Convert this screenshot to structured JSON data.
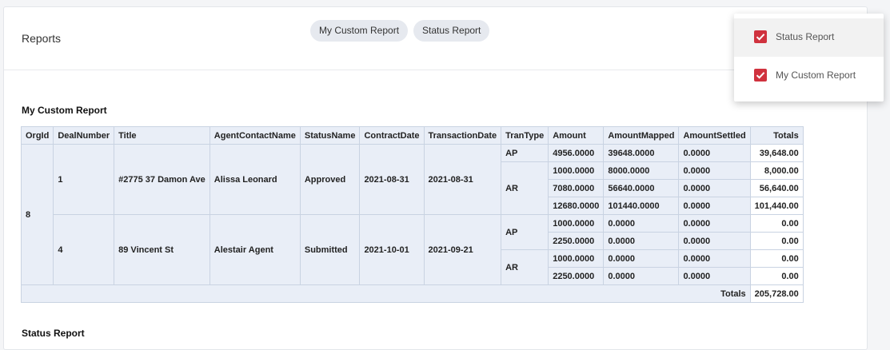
{
  "header": {
    "title": "Reports",
    "chips": [
      "My Custom Report",
      "Status Report"
    ]
  },
  "dropdown": {
    "items": [
      {
        "label": "Status Report",
        "checked": true
      },
      {
        "label": "My Custom Report",
        "checked": true
      }
    ]
  },
  "report1": {
    "title": "My Custom Report",
    "columns": [
      "OrgId",
      "DealNumber",
      "Title",
      "AgentContactName",
      "StatusName",
      "ContractDate",
      "TransactionDate",
      "TranType",
      "Amount",
      "AmountMapped",
      "AmountSettled",
      "Totals"
    ],
    "org_id": "8",
    "deals": [
      {
        "deal_number": "1",
        "title": "#2775 37 Damon Ave",
        "agent": "Alissa Leonard",
        "status": "Approved",
        "contract_date": "2021-08-31",
        "transaction_date": "2021-08-31",
        "groups": [
          {
            "tran_type": "AP",
            "rows": [
              {
                "amount": "4956.0000",
                "mapped": "39648.0000",
                "settled": "0.0000",
                "total": "39,648.00"
              }
            ]
          },
          {
            "tran_type": "AR",
            "rows": [
              {
                "amount": "1000.0000",
                "mapped": "8000.0000",
                "settled": "0.0000",
                "total": "8,000.00"
              },
              {
                "amount": "7080.0000",
                "mapped": "56640.0000",
                "settled": "0.0000",
                "total": "56,640.00"
              },
              {
                "amount": "12680.0000",
                "mapped": "101440.0000",
                "settled": "0.0000",
                "total": "101,440.00"
              }
            ]
          }
        ]
      },
      {
        "deal_number": "4",
        "title": "89 Vincent St",
        "agent": "Alestair Agent",
        "status": "Submitted",
        "contract_date": "2021-10-01",
        "transaction_date": "2021-09-21",
        "groups": [
          {
            "tran_type": "AP",
            "rows": [
              {
                "amount": "1000.0000",
                "mapped": "0.0000",
                "settled": "0.0000",
                "total": "0.00"
              },
              {
                "amount": "2250.0000",
                "mapped": "0.0000",
                "settled": "0.0000",
                "total": "0.00"
              }
            ]
          },
          {
            "tran_type": "AR",
            "rows": [
              {
                "amount": "1000.0000",
                "mapped": "0.0000",
                "settled": "0.0000",
                "total": "0.00"
              },
              {
                "amount": "2250.0000",
                "mapped": "0.0000",
                "settled": "0.0000",
                "total": "0.00"
              }
            ]
          }
        ]
      }
    ],
    "grand_total_label": "Totals",
    "grand_total": "205,728.00"
  },
  "report2": {
    "title": "Status Report"
  },
  "colors": {
    "accent": "#d0323e",
    "table_bg": "#e9eef7",
    "chip_bg": "#e6e9ef"
  }
}
